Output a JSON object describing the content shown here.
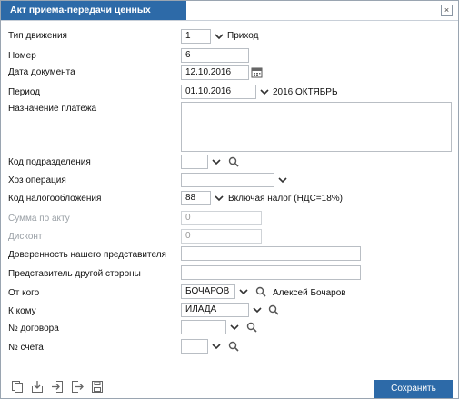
{
  "dialog": {
    "title": "Акт приема-передачи ценных бумаг",
    "close": "×",
    "save_label": "Сохранить"
  },
  "fields": {
    "movement_type": {
      "label": "Тип движения",
      "value": "1",
      "after": "Приход"
    },
    "number": {
      "label": "Номер",
      "value": "6"
    },
    "doc_date": {
      "label": "Дата документа",
      "value": "12.10.2016"
    },
    "period": {
      "label": "Период",
      "value": "01.10.2016",
      "after": "2016 ОКТЯБРЬ"
    },
    "payment_purpose": {
      "label": "Назначение платежа",
      "value": ""
    },
    "division_code": {
      "label": "Код подразделения",
      "value": ""
    },
    "business_op": {
      "label": "Хоз операция",
      "value": ""
    },
    "tax_code": {
      "label": "Код налогообложения",
      "value": "88",
      "after": "Включая налог (НДС=18%)"
    },
    "act_sum": {
      "label": "Сумма по акту",
      "value": "0"
    },
    "discount": {
      "label": "Дисконт",
      "value": "0"
    },
    "our_proxy": {
      "label": "Доверенность нашего представителя",
      "value": ""
    },
    "other_rep": {
      "label": "Представитель другой стороны",
      "value": ""
    },
    "from_whom": {
      "label": "От кого",
      "value": "БОЧАРОВ",
      "after": "Алексей Бочаров"
    },
    "to_whom": {
      "label": "К кому",
      "value": "ИЛАДА"
    },
    "contract_no": {
      "label": "№ договора",
      "value": ""
    },
    "account_no": {
      "label": "№ счета",
      "value": ""
    }
  },
  "colors": {
    "accent": "#2d6aa8",
    "border": "#b9bec4"
  },
  "icons": {
    "toolbar": [
      "copy-icon",
      "import-icon",
      "login-icon",
      "logout-icon",
      "save-disk-icon"
    ]
  }
}
